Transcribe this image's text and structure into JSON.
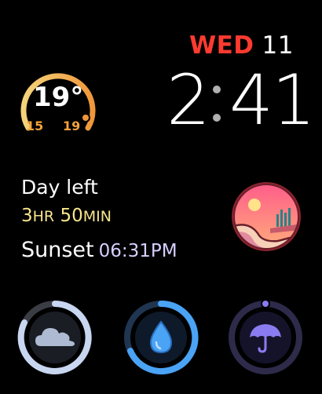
{
  "date": {
    "day": "WED",
    "number": "11"
  },
  "time": {
    "hour": "2",
    "minutes_tens": "4",
    "minutes_ones": "1"
  },
  "weather": {
    "current": "19°",
    "low": "15",
    "high": "19"
  },
  "daylight": {
    "label": "Day left",
    "hours_value": "3",
    "hours_unit": "HR",
    "minutes_value": "50",
    "minutes_unit": "MIN",
    "sunset_label": "Sunset",
    "sunset_time": "06:31PM"
  },
  "colors": {
    "date_day": "#ff3b30",
    "temp_accent": "#f2a23a",
    "duration": "#f6e58d",
    "sunset_time": "#d7cfff",
    "cloud_ring": "#c8d6f0",
    "drop_ring": "#4aa3f5",
    "umbrella_ring": "#8a7cf0"
  },
  "complications": [
    {
      "name": "cloud-cover",
      "icon": "cloud-icon"
    },
    {
      "name": "precipitation",
      "icon": "water-drop-icon"
    },
    {
      "name": "rain-chance",
      "icon": "umbrella-icon"
    }
  ]
}
